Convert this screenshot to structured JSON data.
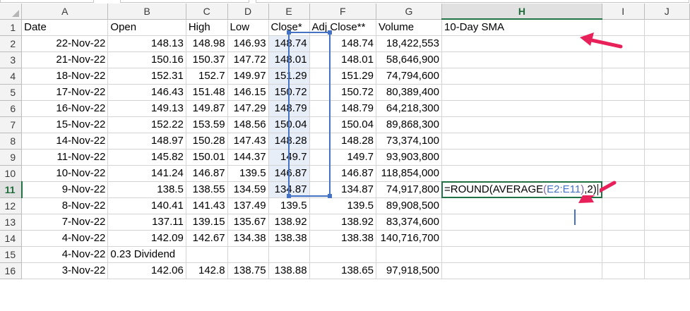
{
  "colors": {
    "accent": "#217346",
    "range_highlight": "#4472c4",
    "arrow": "#e8215a",
    "formula_paren": "#8064a2"
  },
  "columns": [
    "A",
    "B",
    "C",
    "D",
    "E",
    "F",
    "G",
    "H",
    "I",
    "J"
  ],
  "active_column": "H",
  "active_row": "11",
  "rows": [
    {
      "n": "1",
      "a": "Date",
      "b": "Open",
      "c": "High",
      "d": "Low",
      "e": "Close*",
      "f": "Adj Close**",
      "g": "Volume",
      "h": "10-Day SMA"
    },
    {
      "n": "2",
      "a": "22-Nov-22",
      "b": "148.13",
      "c": "148.98",
      "d": "146.93",
      "e": "148.74",
      "f": "148.74",
      "g": "18,422,553",
      "h": ""
    },
    {
      "n": "3",
      "a": "21-Nov-22",
      "b": "150.16",
      "c": "150.37",
      "d": "147.72",
      "e": "148.01",
      "f": "148.01",
      "g": "58,646,900",
      "h": ""
    },
    {
      "n": "4",
      "a": "18-Nov-22",
      "b": "152.31",
      "c": "152.7",
      "d": "149.97",
      "e": "151.29",
      "f": "151.29",
      "g": "74,794,600",
      "h": ""
    },
    {
      "n": "5",
      "a": "17-Nov-22",
      "b": "146.43",
      "c": "151.48",
      "d": "146.15",
      "e": "150.72",
      "f": "150.72",
      "g": "80,389,400",
      "h": ""
    },
    {
      "n": "6",
      "a": "16-Nov-22",
      "b": "149.13",
      "c": "149.87",
      "d": "147.29",
      "e": "148.79",
      "f": "148.79",
      "g": "64,218,300",
      "h": ""
    },
    {
      "n": "7",
      "a": "15-Nov-22",
      "b": "152.22",
      "c": "153.59",
      "d": "148.56",
      "e": "150.04",
      "f": "150.04",
      "g": "89,868,300",
      "h": ""
    },
    {
      "n": "8",
      "a": "14-Nov-22",
      "b": "148.97",
      "c": "150.28",
      "d": "147.43",
      "e": "148.28",
      "f": "148.28",
      "g": "73,374,100",
      "h": ""
    },
    {
      "n": "9",
      "a": "11-Nov-22",
      "b": "145.82",
      "c": "150.01",
      "d": "144.37",
      "e": "149.7",
      "f": "149.7",
      "g": "93,903,800",
      "h": ""
    },
    {
      "n": "10",
      "a": "10-Nov-22",
      "b": "141.24",
      "c": "146.87",
      "d": "139.5",
      "e": "146.87",
      "f": "146.87",
      "g": "118,854,000",
      "h": ""
    },
    {
      "n": "11",
      "a": "9-Nov-22",
      "b": "138.5",
      "c": "138.55",
      "d": "134.59",
      "e": "134.87",
      "f": "134.87",
      "g": "74,917,800",
      "h": ""
    },
    {
      "n": "12",
      "a": "8-Nov-22",
      "b": "140.41",
      "c": "141.43",
      "d": "137.49",
      "e": "139.5",
      "f": "139.5",
      "g": "89,908,500",
      "h": ""
    },
    {
      "n": "13",
      "a": "7-Nov-22",
      "b": "137.11",
      "c": "139.15",
      "d": "135.67",
      "e": "138.92",
      "f": "138.92",
      "g": "83,374,600",
      "h": ""
    },
    {
      "n": "14",
      "a": "4-Nov-22",
      "b": "142.09",
      "c": "142.67",
      "d": "134.38",
      "e": "138.38",
      "f": "138.38",
      "g": "140,716,700",
      "h": ""
    },
    {
      "n": "15",
      "a": "4-Nov-22",
      "b": "0.23 Dividend",
      "c": "",
      "d": "",
      "e": "",
      "f": "",
      "g": "",
      "h": ""
    },
    {
      "n": "16",
      "a": "3-Nov-22",
      "b": "142.06",
      "c": "142.8",
      "d": "138.75",
      "e": "138.88",
      "f": "138.65",
      "g": "97,918,500",
      "h": ""
    }
  ],
  "formula": {
    "prefix": "=ROUND(AVERAGE",
    "open_paren": "(",
    "range": "E2:E11",
    "close_paren": ")",
    "suffix": ",2)"
  }
}
